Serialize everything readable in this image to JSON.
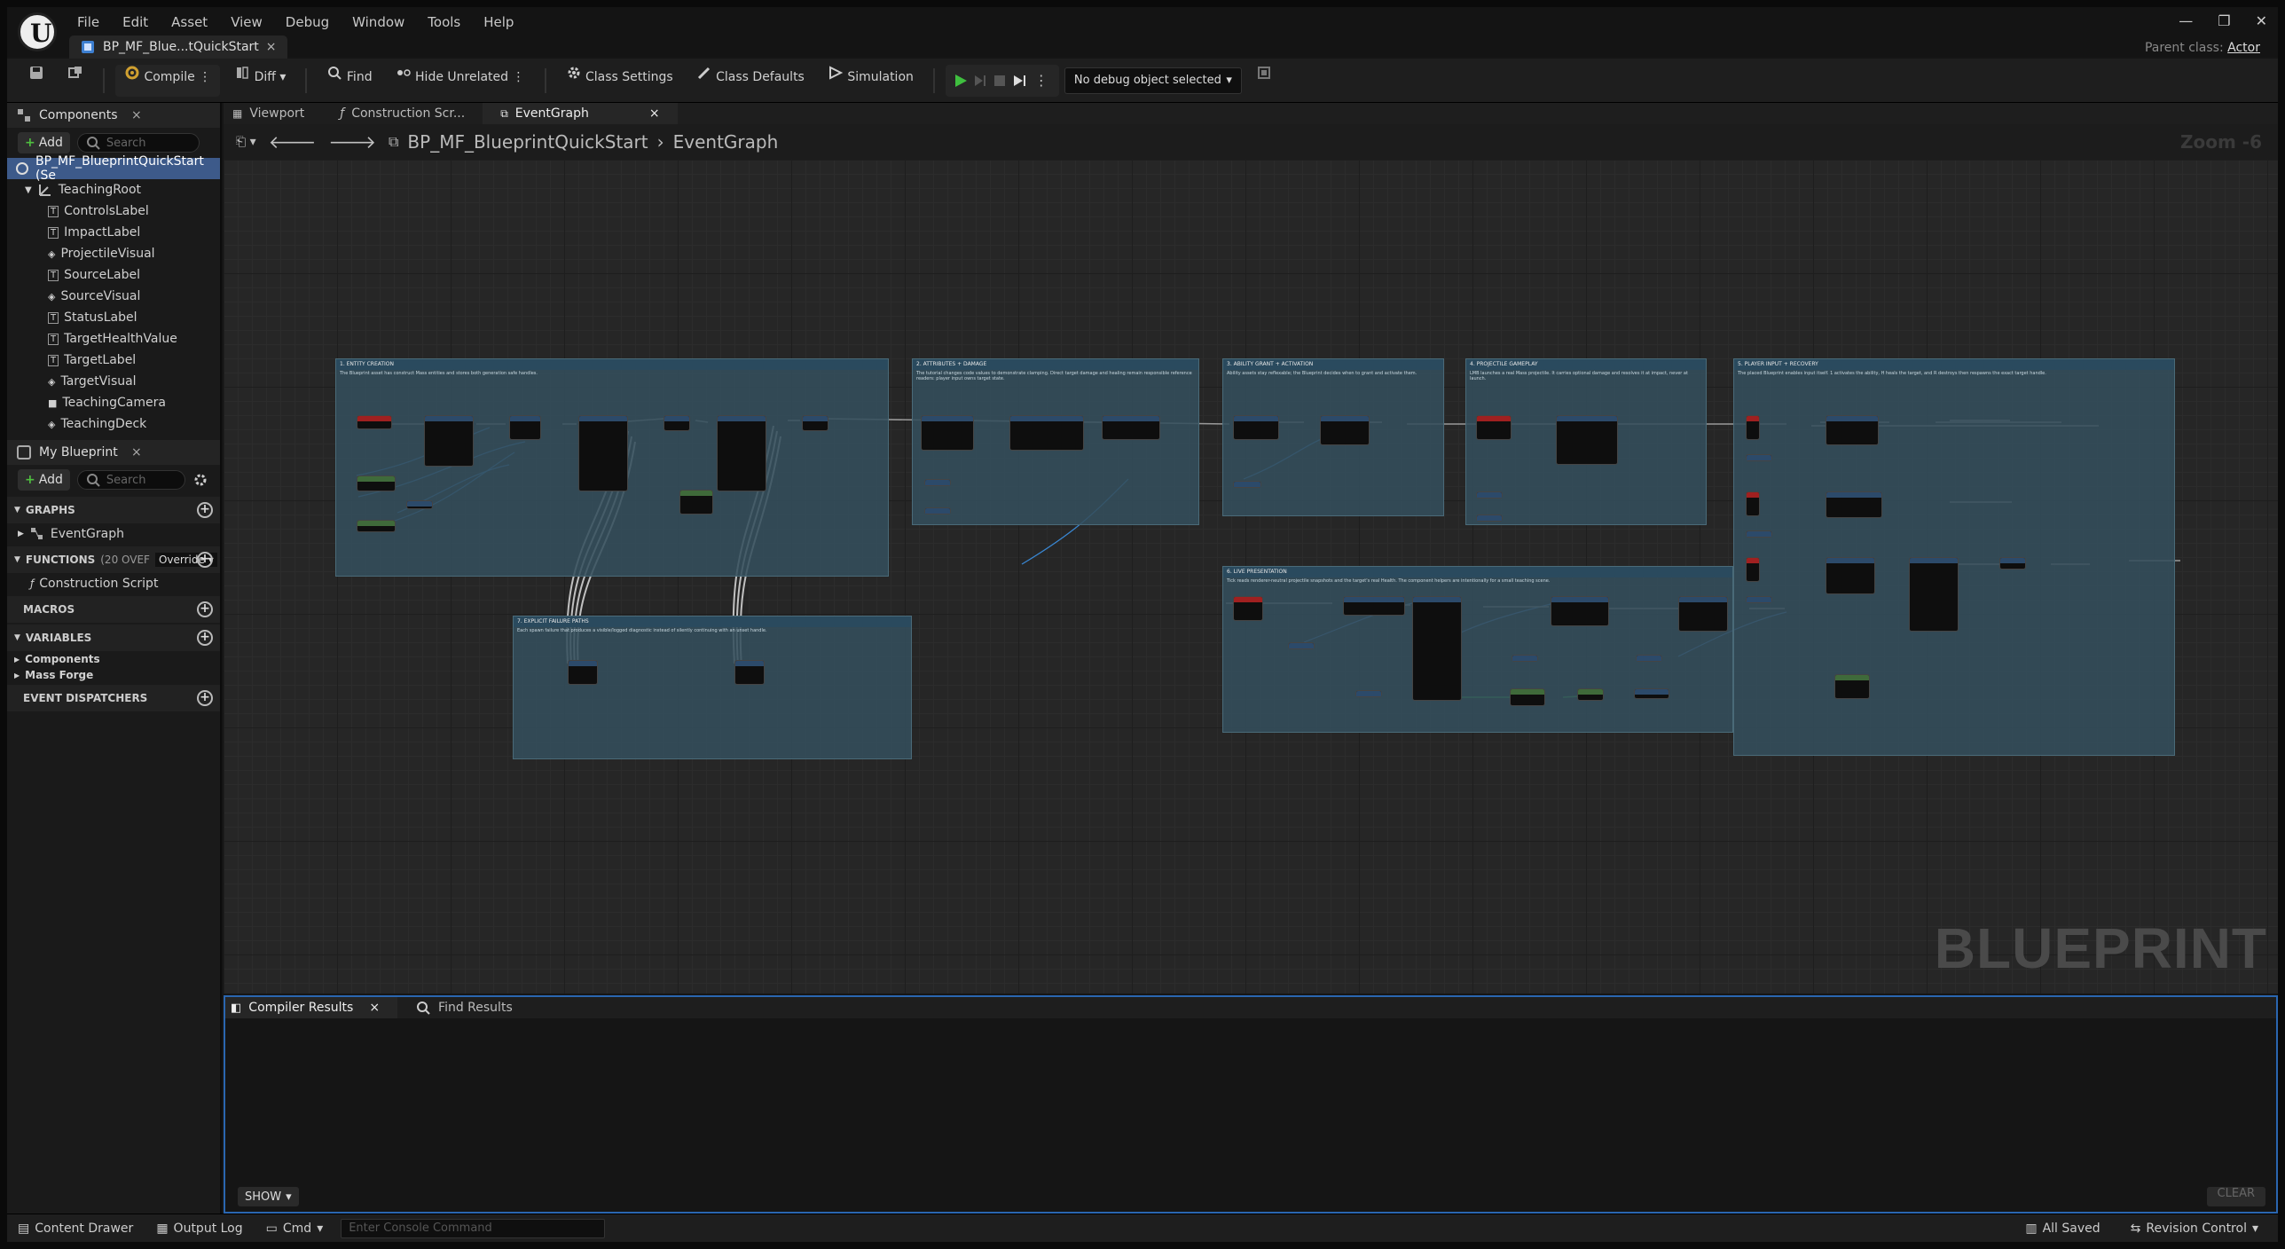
{
  "menu": [
    "File",
    "Edit",
    "Asset",
    "View",
    "Debug",
    "Window",
    "Tools",
    "Help"
  ],
  "document_tab": "BP_MF_Blue...tQuickStart",
  "parent_class": {
    "label": "Parent class:",
    "value": "Actor"
  },
  "toolbar": {
    "compile": "Compile",
    "diff": "Diff",
    "find": "Find",
    "hide_unrelated": "Hide Unrelated",
    "class_settings": "Class Settings",
    "class_defaults": "Class Defaults",
    "simulation": "Simulation",
    "debug_object": "No debug object selected"
  },
  "components": {
    "tab": "Components",
    "add": "Add",
    "search_placeholder": "Search",
    "root": "BP_MF_BlueprintQuickStart (Se",
    "teaching_root": "TeachingRoot",
    "children": [
      "ControlsLabel",
      "ImpactLabel",
      "ProjectileVisual",
      "SourceLabel",
      "SourceVisual",
      "StatusLabel",
      "TargetHealthValue",
      "TargetLabel",
      "TargetVisual",
      "TeachingCamera",
      "TeachingDeck"
    ]
  },
  "my_blueprint": {
    "tab": "My Blueprint",
    "add": "Add",
    "search_placeholder": "Search",
    "graphs": "GRAPHS",
    "event_graph": "EventGraph",
    "functions": "FUNCTIONS",
    "functions_count": "(20 OVEF",
    "override": "Override",
    "construction_script": "Construction Script",
    "macros": "MACROS",
    "variables": "VARIABLES",
    "var_components": "Components",
    "var_mass_forge": "Mass Forge",
    "event_dispatchers": "EVENT DISPATCHERS"
  },
  "graph_tabs": [
    "Viewport",
    "Construction Scr...",
    "EventGraph"
  ],
  "breadcrumb": {
    "blueprint": "BP_MF_BlueprintQuickStart",
    "graph": "EventGraph"
  },
  "zoom": "Zoom -6",
  "watermark": "BLUEPRINT",
  "comment_boxes": [
    {
      "title": "1. ENTITY CREATION",
      "desc": "The Blueprint asset has construct Mass entities and stores both generation safe handles."
    },
    {
      "title": "2. ATTRIBUTES + DAMAGE",
      "desc": "The tutorial changes code values to demonstrate clamping. Direct target damage and healing remain responsible reference readers: player input owns target state."
    },
    {
      "title": "3. ABILITY GRANT + ACTIVATION",
      "desc": "Ability assets stay reflexable; the Blueprint decides when to grant and activate them."
    },
    {
      "title": "4. PROJECTILE GAMEPLAY",
      "desc": "LMB launches a real Mass projectile. It carries optional damage and resolves it at impact, never at launch."
    },
    {
      "title": "5. PLAYER INPUT + RECOVERY",
      "desc": "The placed Blueprint enables input itself. 1 activates the ability, H heals the target, and R destroys then respawns the exact target handle."
    },
    {
      "title": "7. EXPLICIT FAILURE PATHS",
      "desc": "Each spawn failure that produces a visible/logged diagnostic instead of silently continuing with an unset handle."
    },
    {
      "title": "6. LIVE PRESENTATION",
      "desc": "Tick reads renderer-neutral projectile snapshots and the target's real Health. The component helpers are intentionally for a small teaching scene."
    }
  ],
  "bottom_tabs": [
    "Compiler Results",
    "Find Results"
  ],
  "show": "SHOW",
  "clear": "CLEAR",
  "status": {
    "content_drawer": "Content Drawer",
    "output_log": "Output Log",
    "cmd": "Cmd",
    "console_placeholder": "Enter Console Command",
    "saved": "All Saved",
    "revision": "Revision Control"
  }
}
